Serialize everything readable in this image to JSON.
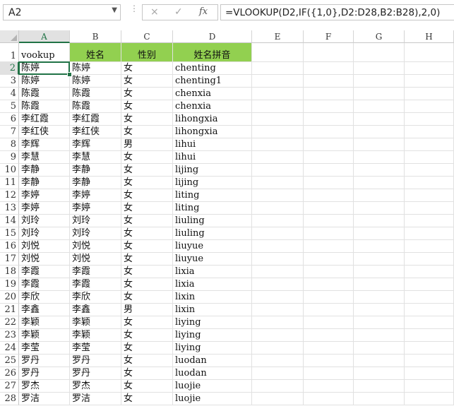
{
  "name_box": {
    "value": "A2"
  },
  "formula_bar": {
    "cancel_icon": "×",
    "enter_icon": "✓",
    "fx_label": "fx",
    "formula": "=VLOOKUP(D2,IF({1,0},D2:D28,B2:B28),2,0)"
  },
  "columns": [
    "A",
    "B",
    "C",
    "D",
    "E",
    "F",
    "G",
    "H"
  ],
  "header_row": {
    "row_number": "1",
    "a": "vookup",
    "b": "姓名",
    "c": "性别",
    "d": "姓名拼音"
  },
  "header_fill_color": "#92d050",
  "selection_color": "#217346",
  "rows": [
    {
      "n": "2",
      "a": "陈婷",
      "b": "陈婷",
      "c": "女",
      "d": "chenting"
    },
    {
      "n": "3",
      "a": "陈婷",
      "b": "陈婷",
      "c": "女",
      "d": "chenting1"
    },
    {
      "n": "4",
      "a": "陈霞",
      "b": "陈霞",
      "c": "女",
      "d": "chenxia"
    },
    {
      "n": "5",
      "a": "陈霞",
      "b": "陈霞",
      "c": "女",
      "d": "chenxia"
    },
    {
      "n": "6",
      "a": "李红霞",
      "b": "李红霞",
      "c": "女",
      "d": "lihongxia"
    },
    {
      "n": "7",
      "a": "李红侠",
      "b": "李红侠",
      "c": "女",
      "d": "lihongxia"
    },
    {
      "n": "8",
      "a": "李辉",
      "b": "李辉",
      "c": "男",
      "d": "lihui"
    },
    {
      "n": "9",
      "a": "李慧",
      "b": "李慧",
      "c": "女",
      "d": "lihui"
    },
    {
      "n": "10",
      "a": "李静",
      "b": "李静",
      "c": "女",
      "d": "lijing"
    },
    {
      "n": "11",
      "a": "李静",
      "b": "李静",
      "c": "女",
      "d": "lijing"
    },
    {
      "n": "12",
      "a": "李婷",
      "b": "李婷",
      "c": "女",
      "d": "liting"
    },
    {
      "n": "13",
      "a": "李婷",
      "b": "李婷",
      "c": "女",
      "d": "liting"
    },
    {
      "n": "14",
      "a": "刘玲",
      "b": "刘玲",
      "c": "女",
      "d": "liuling"
    },
    {
      "n": "15",
      "a": "刘玲",
      "b": "刘玲",
      "c": "女",
      "d": "liuling"
    },
    {
      "n": "16",
      "a": "刘悦",
      "b": "刘悦",
      "c": "女",
      "d": "liuyue"
    },
    {
      "n": "17",
      "a": "刘悦",
      "b": "刘悦",
      "c": "女",
      "d": "liuyue"
    },
    {
      "n": "18",
      "a": "李霞",
      "b": "李霞",
      "c": "女",
      "d": "lixia"
    },
    {
      "n": "19",
      "a": "李霞",
      "b": "李霞",
      "c": "女",
      "d": "lixia"
    },
    {
      "n": "20",
      "a": "李欣",
      "b": "李欣",
      "c": "女",
      "d": "lixin"
    },
    {
      "n": "21",
      "a": "李鑫",
      "b": "李鑫",
      "c": "男",
      "d": "lixin"
    },
    {
      "n": "22",
      "a": "李颖",
      "b": "李颖",
      "c": "女",
      "d": "liying"
    },
    {
      "n": "23",
      "a": "李颖",
      "b": "李颖",
      "c": "女",
      "d": "liying"
    },
    {
      "n": "24",
      "a": "李莹",
      "b": "李莹",
      "c": "女",
      "d": "liying"
    },
    {
      "n": "25",
      "a": "罗丹",
      "b": "罗丹",
      "c": "女",
      "d": "luodan"
    },
    {
      "n": "26",
      "a": "罗丹",
      "b": "罗丹",
      "c": "女",
      "d": "luodan"
    },
    {
      "n": "27",
      "a": "罗杰",
      "b": "罗杰",
      "c": "女",
      "d": "luojie"
    },
    {
      "n": "28",
      "a": "罗洁",
      "b": "罗洁",
      "c": "女",
      "d": "luojie"
    }
  ]
}
